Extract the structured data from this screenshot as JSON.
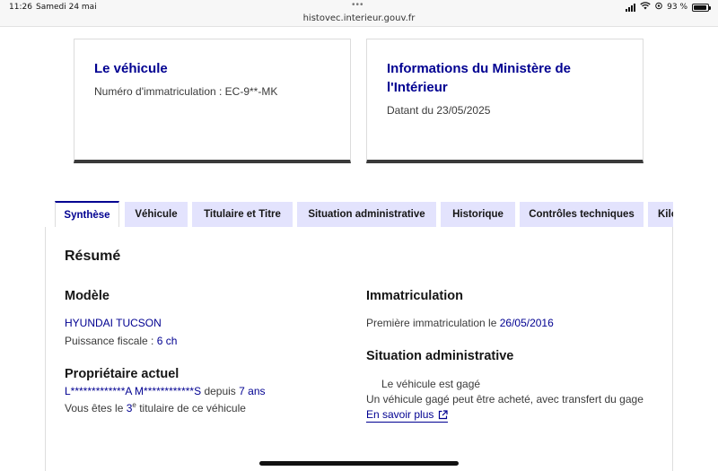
{
  "status": {
    "time": "11:26",
    "date": "Samedi 24 mai",
    "dots": "•••",
    "url": "histovec.interieur.gouv.fr",
    "battery_text": "93 %"
  },
  "cards": {
    "vehicle": {
      "title": "Le véhicule",
      "text": "Numéro d'immatriculation : EC-9**-MK"
    },
    "ministry": {
      "title_line1": "Informations du Ministère de",
      "title_line2": "l'Intérieur",
      "text": "Datant du 23/05/2025"
    }
  },
  "tabs": [
    {
      "label": "Synthèse"
    },
    {
      "label": "Véhicule"
    },
    {
      "label": "Titulaire et Titre"
    },
    {
      "label": "Situation administrative"
    },
    {
      "label": "Historique"
    },
    {
      "label": "Contrôles techniques"
    },
    {
      "label": "Kilo"
    }
  ],
  "summary": {
    "title": "Résumé",
    "model": {
      "heading": "Modèle",
      "name": "HYUNDAI TUCSON",
      "power_label": "Puissance fiscale : ",
      "power_value": "6 ch"
    },
    "owner": {
      "heading": "Propriétaire actuel",
      "name": "L*************A M************S",
      "since_label": " depuis ",
      "since_value": "7 ans",
      "rank_prefix": "Vous êtes le ",
      "rank_value": "3",
      "rank_sup": "e",
      "rank_suffix": " titulaire de ce véhicule"
    },
    "registration": {
      "heading": "Immatriculation",
      "first_label": "Première immatriculation le ",
      "first_value": "26/05/2016"
    },
    "admin": {
      "heading": "Situation administrative",
      "status": "Le véhicule est gagé",
      "note": "Un véhicule gagé peut être acheté, avec transfert du gage",
      "link": "En savoir plus"
    }
  }
}
